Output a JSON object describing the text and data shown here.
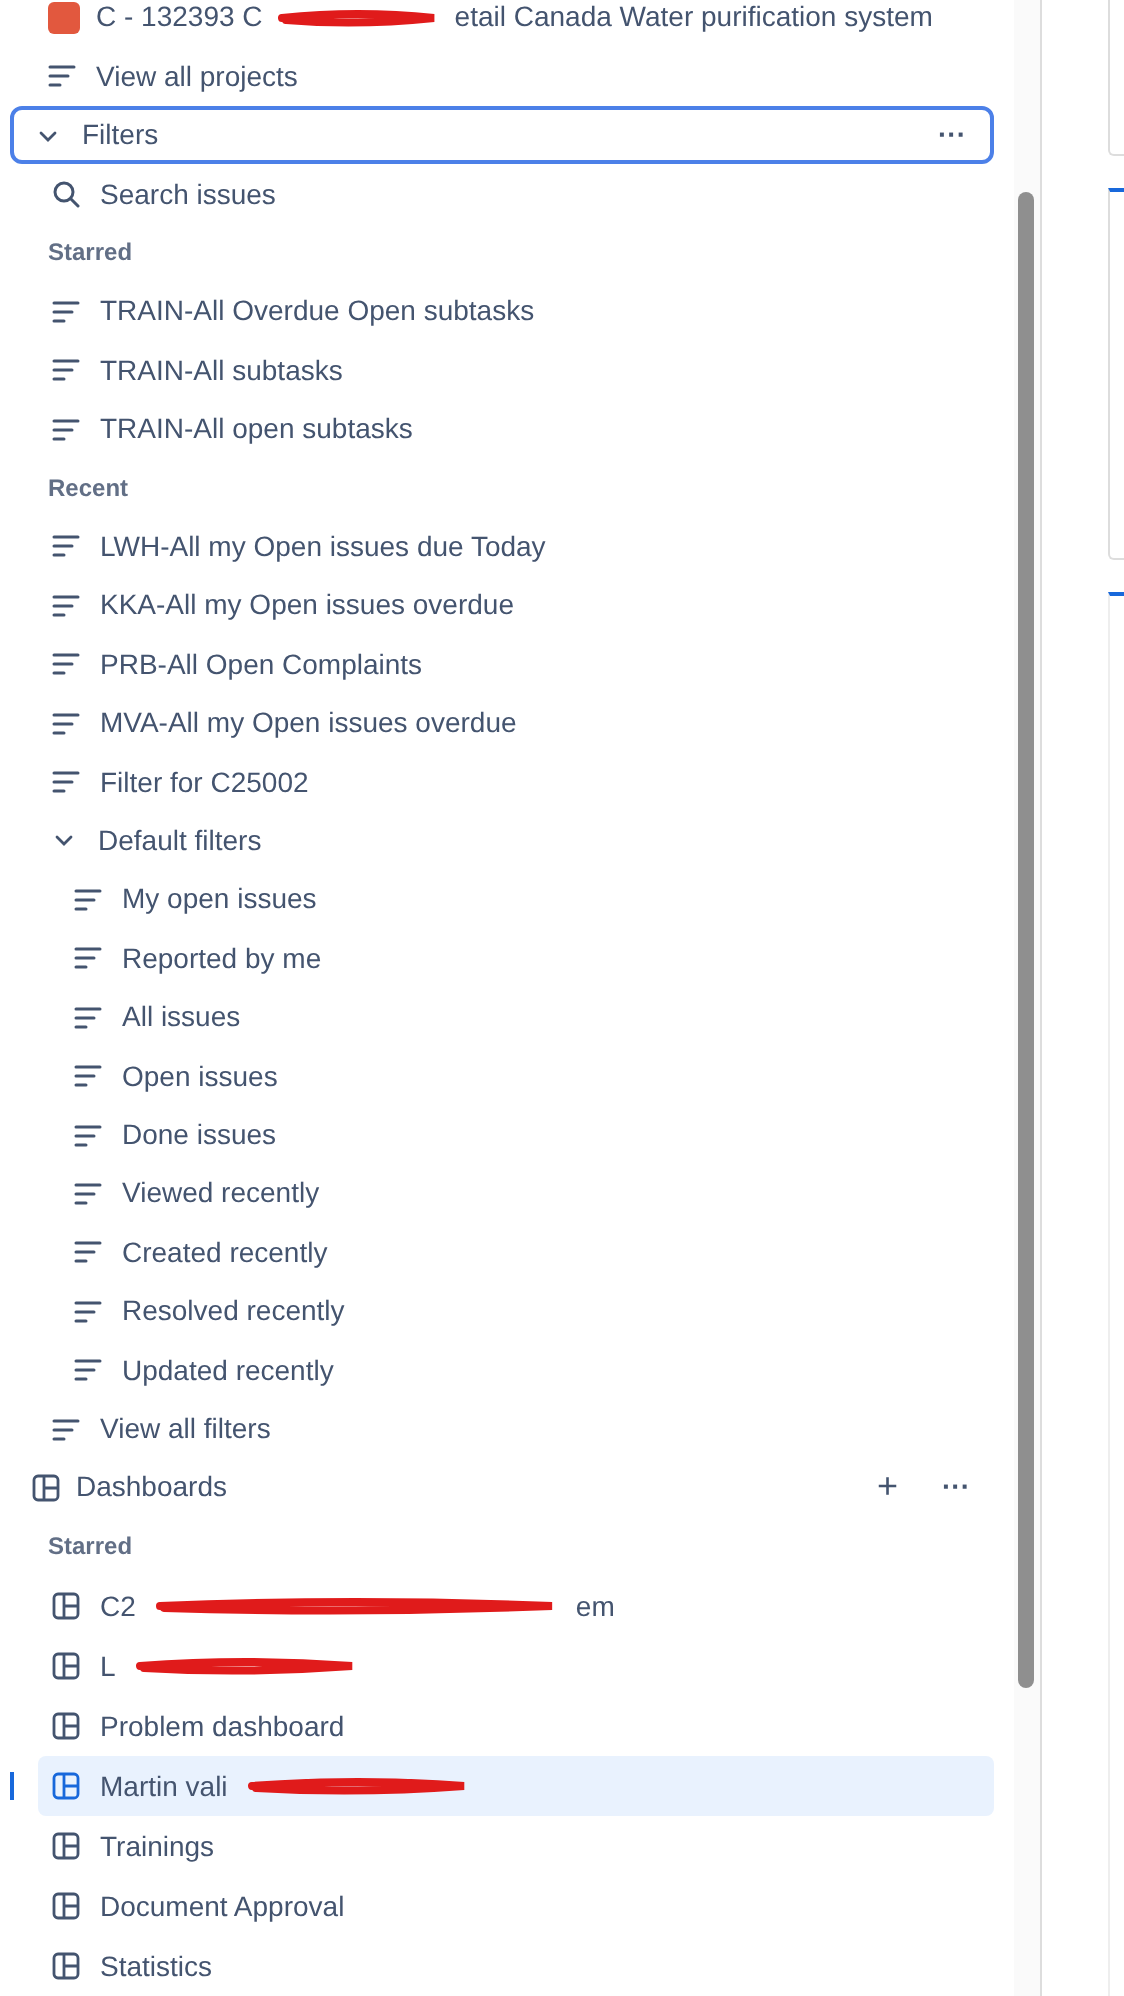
{
  "projects": {
    "items": [
      {
        "kind": "project",
        "label_start": "C - 132393 C",
        "label_end": "etail Canada Water purification system",
        "redacted": true
      },
      {
        "kind": "link",
        "label": "View all projects"
      }
    ]
  },
  "filters": {
    "title": "Filters",
    "expanded": true,
    "focused": true,
    "more": "···",
    "search": "Search issues",
    "groups": [
      {
        "heading": "Starred",
        "items": [
          {
            "label": "TRAIN-All Overdue Open subtasks"
          },
          {
            "label": "TRAIN-All subtasks"
          },
          {
            "label": "TRAIN-All open subtasks"
          }
        ]
      },
      {
        "heading": "Recent",
        "items": [
          {
            "label": "LWH-All my Open issues due Today"
          },
          {
            "label": "KKA-All my Open issues overdue"
          },
          {
            "label": "PRB-All Open Complaints"
          },
          {
            "label": "MVA-All my Open issues overdue"
          },
          {
            "label": "Filter for C25002"
          }
        ]
      }
    ],
    "default_filters": {
      "title": "Default filters",
      "expanded": true,
      "children": [
        {
          "label": "My open issues"
        },
        {
          "label": "Reported by me"
        },
        {
          "label": "All issues"
        },
        {
          "label": "Open issues"
        },
        {
          "label": "Done issues"
        },
        {
          "label": "Viewed recently"
        },
        {
          "label": "Created recently"
        },
        {
          "label": "Resolved recently"
        },
        {
          "label": "Updated recently"
        }
      ]
    },
    "view_all": "View all filters"
  },
  "dashboards": {
    "title": "Dashboards",
    "add": "+",
    "more": "···",
    "heading": "Starred",
    "items": [
      {
        "label_start": "C2",
        "label_end": "em",
        "redacted": true,
        "selected": false
      },
      {
        "label_start": "L",
        "redacted": true,
        "selected": false
      },
      {
        "label_start": "Problem dashboard",
        "redacted": false,
        "selected": false
      },
      {
        "label_start": "Martin vali",
        "redacted": true,
        "selected": true
      },
      {
        "label_start": "Trainings",
        "redacted": false,
        "selected": false
      },
      {
        "label_start": "Document Approval",
        "redacted": false,
        "selected": false
      },
      {
        "label_start": "Statistics",
        "redacted": false,
        "selected": false
      }
    ]
  }
}
